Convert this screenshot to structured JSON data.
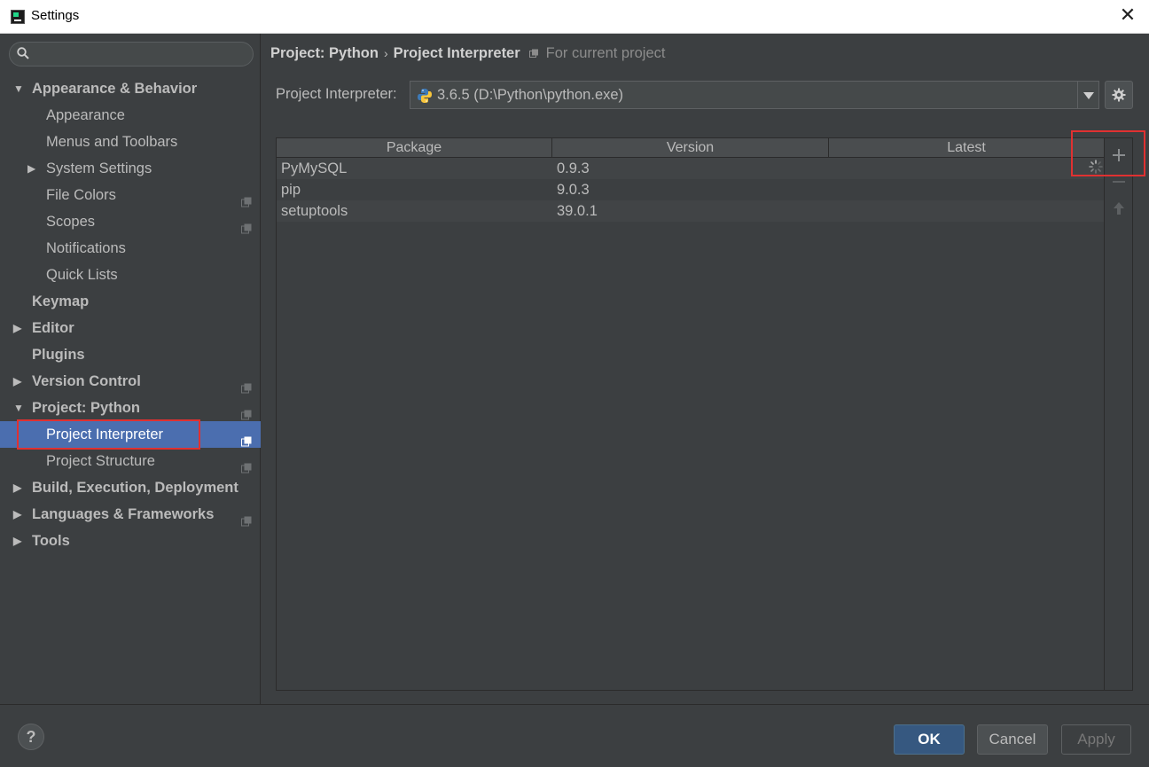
{
  "window": {
    "title": "Settings",
    "close_glyph": "✕"
  },
  "search": {
    "placeholder": ""
  },
  "sidebar": {
    "items": [
      {
        "label": "Appearance & Behavior",
        "level": 1,
        "bold": true,
        "arrow": "▼"
      },
      {
        "label": "Appearance",
        "level": 2
      },
      {
        "label": "Menus and Toolbars",
        "level": 2
      },
      {
        "label": "System Settings",
        "level": 2,
        "arrow": "▶"
      },
      {
        "label": "File Colors",
        "level": 2,
        "project_icon": true
      },
      {
        "label": "Scopes",
        "level": 2,
        "project_icon": true
      },
      {
        "label": "Notifications",
        "level": 2
      },
      {
        "label": "Quick Lists",
        "level": 2
      },
      {
        "label": "Keymap",
        "level": 1,
        "bold": true
      },
      {
        "label": "Editor",
        "level": 1,
        "bold": true,
        "arrow": "▶"
      },
      {
        "label": "Plugins",
        "level": 1,
        "bold": true
      },
      {
        "label": "Version Control",
        "level": 1,
        "bold": true,
        "arrow": "▶",
        "project_icon": true
      },
      {
        "label": "Project: Python",
        "level": 1,
        "bold": true,
        "arrow": "▼",
        "project_icon": true
      },
      {
        "label": "Project Interpreter",
        "level": 2,
        "selected": true,
        "project_icon": true
      },
      {
        "label": "Project Structure",
        "level": 2,
        "project_icon": true
      },
      {
        "label": "Build, Execution, Deployment",
        "level": 1,
        "bold": true,
        "arrow": "▶"
      },
      {
        "label": "Languages & Frameworks",
        "level": 1,
        "bold": true,
        "arrow": "▶",
        "project_icon": true
      },
      {
        "label": "Tools",
        "level": 1,
        "bold": true,
        "arrow": "▶"
      }
    ]
  },
  "breadcrumb": {
    "parent": "Project: Python",
    "separator": "›",
    "current": "Project Interpreter",
    "scope": "For current project"
  },
  "interpreter": {
    "label": "Project Interpreter:",
    "value": "3.6.5 (D:\\Python\\python.exe)"
  },
  "table": {
    "columns": [
      "Package",
      "Version",
      "Latest"
    ],
    "rows": [
      {
        "package": "PyMySQL",
        "version": "0.9.3",
        "latest": ""
      },
      {
        "package": "pip",
        "version": "9.0.3",
        "latest": ""
      },
      {
        "package": "setuptools",
        "version": "39.0.1",
        "latest": ""
      }
    ]
  },
  "footer": {
    "help": "?",
    "ok": "OK",
    "cancel": "Cancel",
    "apply": "Apply"
  },
  "colors": {
    "background": "#3c3f41",
    "selection": "#4b6eaf",
    "annotation_red": "#e03131",
    "ok_button": "#365880"
  }
}
